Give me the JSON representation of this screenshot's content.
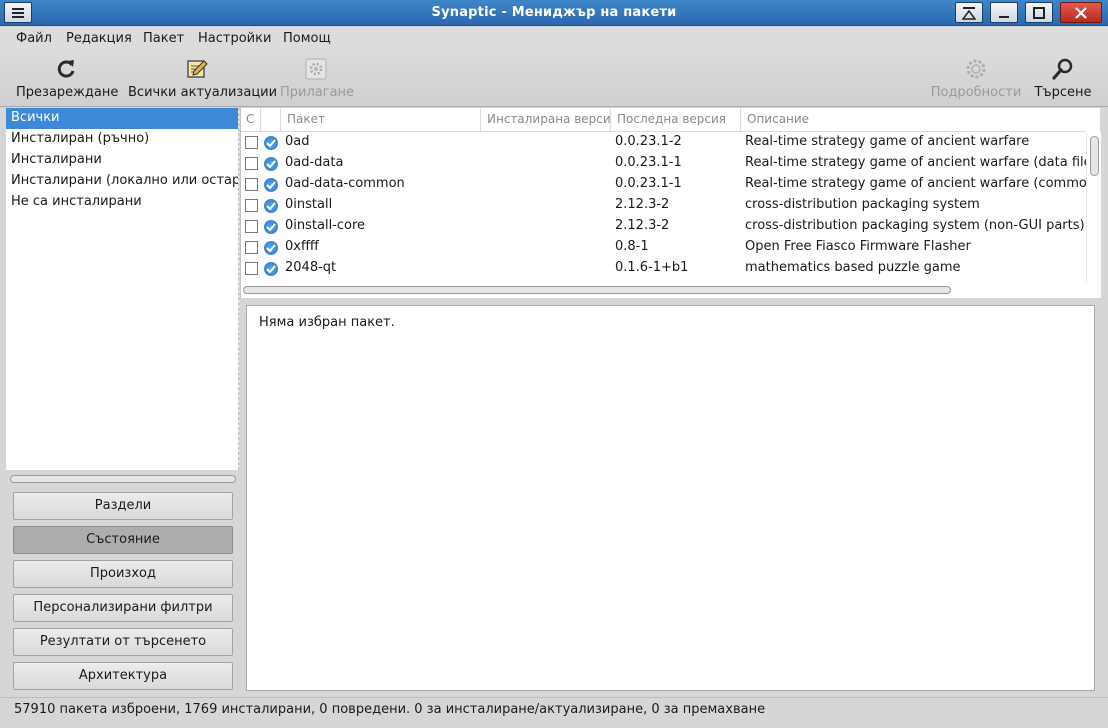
{
  "window": {
    "title": "Synaptic - Мениджър на пакети"
  },
  "menubar": {
    "items": [
      "Файл",
      "Редакция",
      "Пакет",
      "Настройки",
      "Помощ"
    ]
  },
  "toolbar": {
    "reload": "Презареждане",
    "mark_all_upgrades": "Всички актуализации",
    "apply": "Прилагане",
    "properties": "Подробности",
    "search": "Търсене"
  },
  "filters": {
    "items": [
      "Всички",
      "Инсталиран (ръчно)",
      "Инсталирани",
      "Инсталирани (локално или остарели)",
      "Не са инсталирани"
    ],
    "selected_index": 0
  },
  "side_buttons": {
    "sections": "Раздели",
    "status": "Състояние",
    "origin": "Произход",
    "custom_filters": "Персонализирани филтри",
    "search_results": "Резултати от търсенето",
    "architecture": "Архитектура",
    "pressed": "status"
  },
  "table": {
    "columns": {
      "s": "С",
      "package": "Пакет",
      "installed_version": "Инсталирана версия",
      "latest_version": "Последна версия",
      "description": "Описание"
    },
    "rows": [
      {
        "name": "0ad",
        "installed": "",
        "latest": "0.0.23.1-2",
        "description": "Real-time strategy game of ancient warfare"
      },
      {
        "name": "0ad-data",
        "installed": "",
        "latest": "0.0.23.1-1",
        "description": "Real-time strategy game of ancient warfare (data files)"
      },
      {
        "name": "0ad-data-common",
        "installed": "",
        "latest": "0.0.23.1-1",
        "description": "Real-time strategy game of ancient warfare (common data"
      },
      {
        "name": "0install",
        "installed": "",
        "latest": "2.12.3-2",
        "description": "cross-distribution packaging system"
      },
      {
        "name": "0install-core",
        "installed": "",
        "latest": "2.12.3-2",
        "description": "cross-distribution packaging system (non-GUI parts)"
      },
      {
        "name": "0xffff",
        "installed": "",
        "latest": "0.8-1",
        "description": "Open Free Fiasco Firmware Flasher"
      },
      {
        "name": "2048-qt",
        "installed": "",
        "latest": "0.1.6-1+b1",
        "description": "mathematics based puzzle game"
      }
    ]
  },
  "description_panel": {
    "text": "Няма избран пакет."
  },
  "statusbar": {
    "text": "57910 пакета изброени, 1769 инсталирани, 0 повредени. 0 за инсталиране/актуализиране, 0 за премахване"
  },
  "colors": {
    "titlebar": "#2f72b8",
    "selection": "#3d89d6",
    "status_icon": "#2a76c4"
  }
}
